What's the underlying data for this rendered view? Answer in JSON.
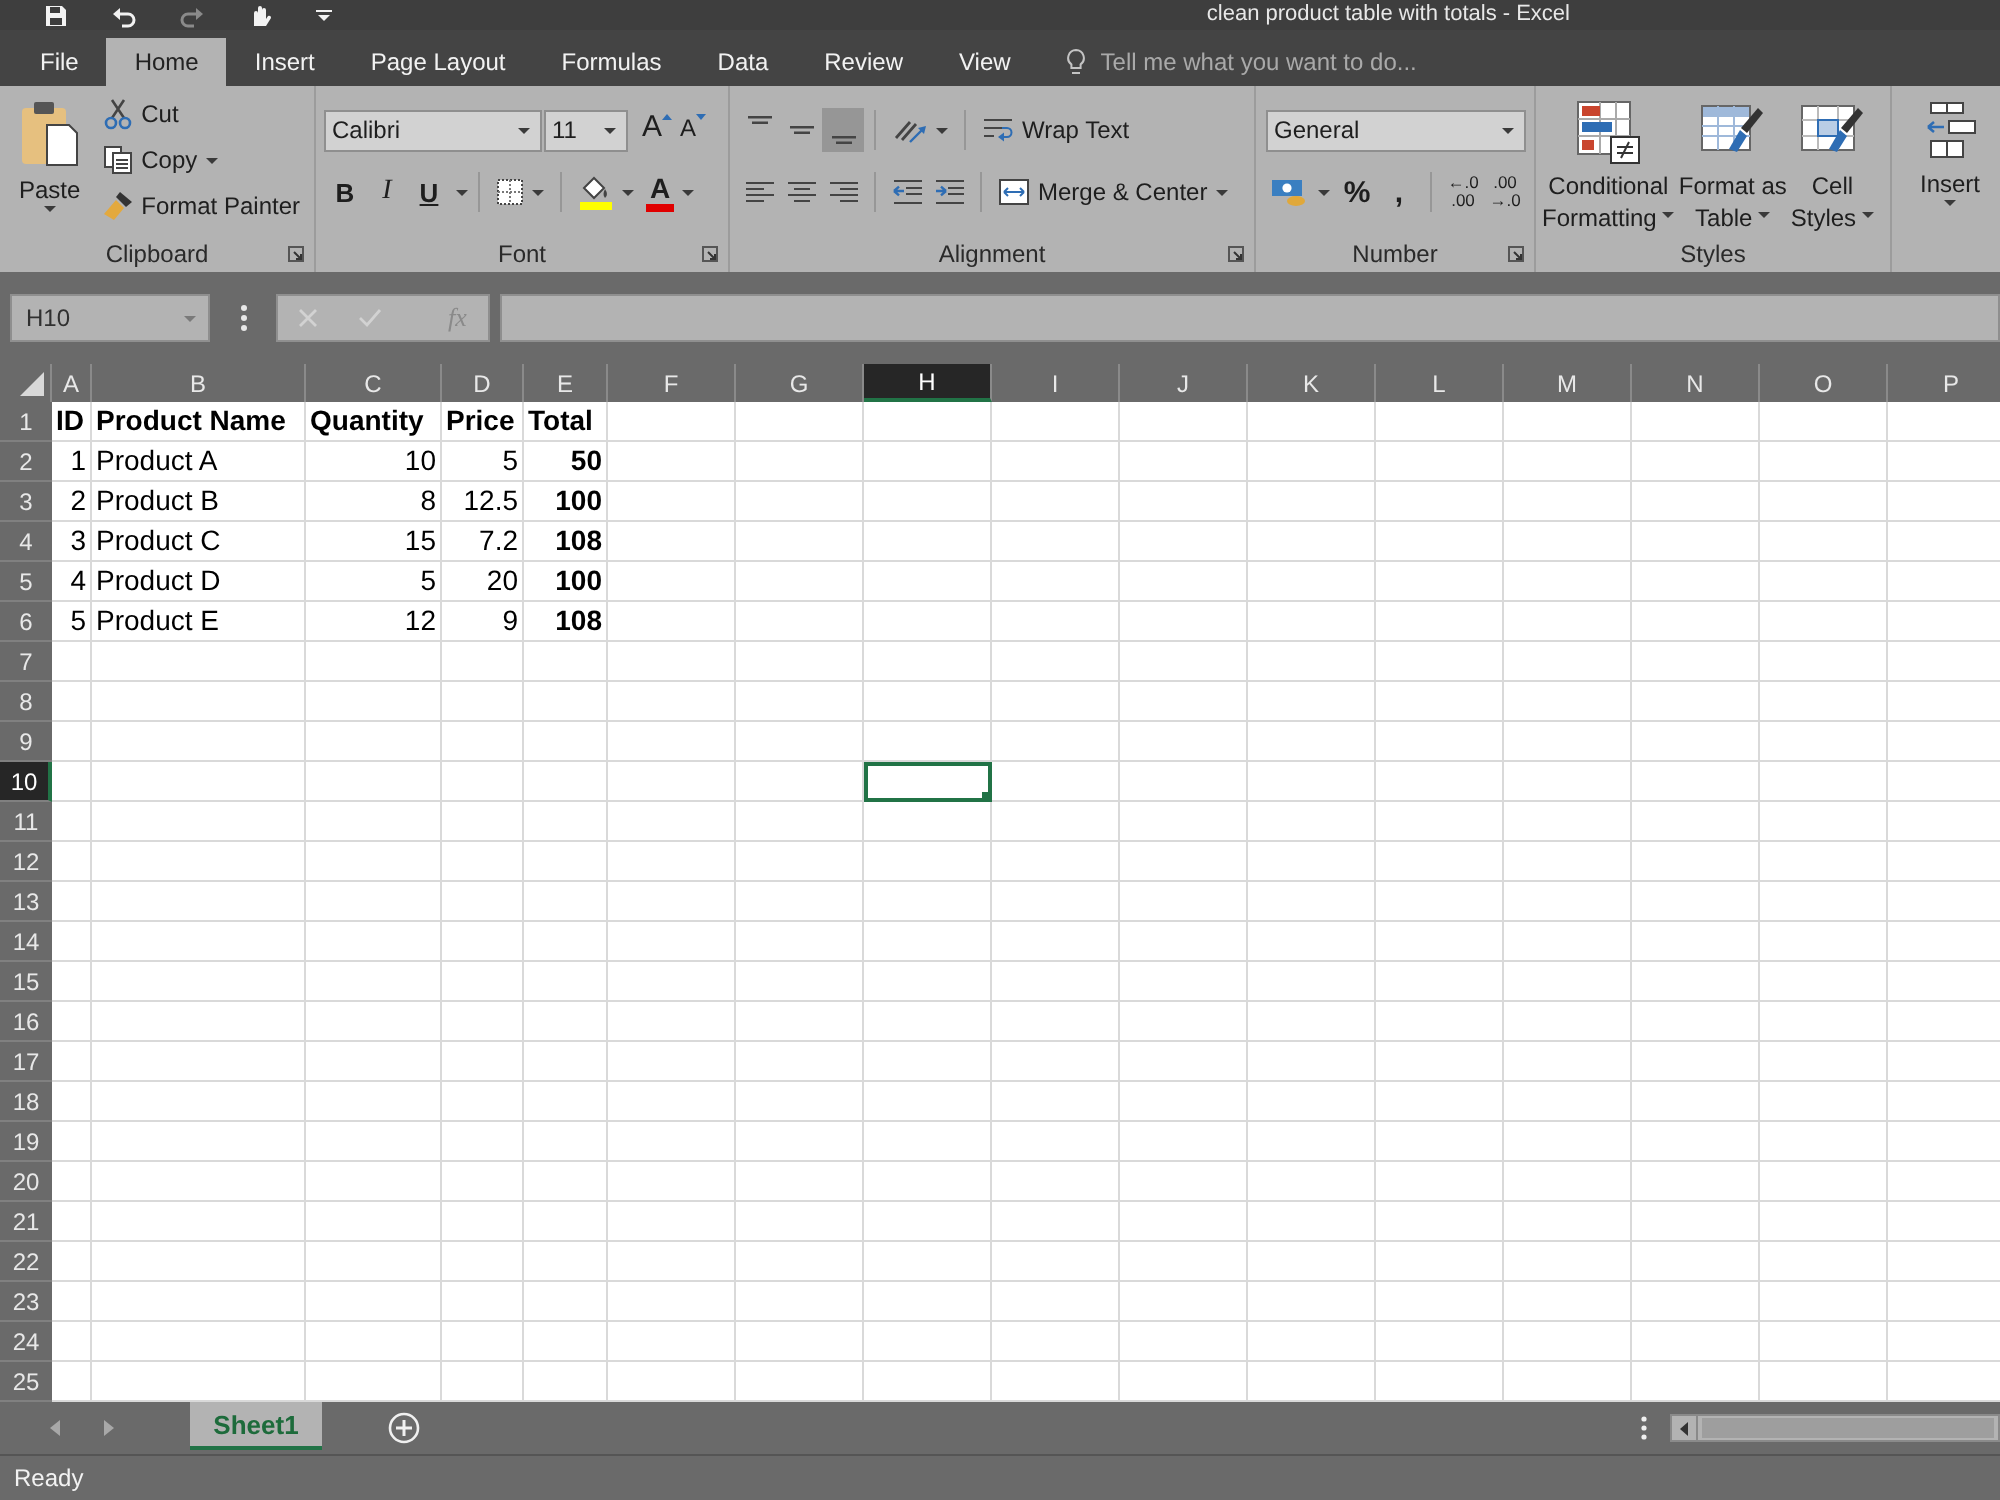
{
  "window": {
    "title": "clean product table with totals - Excel"
  },
  "ribbon_tabs": [
    {
      "label": "File",
      "selected": false
    },
    {
      "label": "Home",
      "selected": true
    },
    {
      "label": "Insert",
      "selected": false
    },
    {
      "label": "Page Layout",
      "selected": false
    },
    {
      "label": "Formulas",
      "selected": false
    },
    {
      "label": "Data",
      "selected": false
    },
    {
      "label": "Review",
      "selected": false
    },
    {
      "label": "View",
      "selected": false
    }
  ],
  "tell_me": {
    "placeholder": "Tell me what you want to do..."
  },
  "ribbon": {
    "clipboard": {
      "label": "Clipboard",
      "paste": "Paste",
      "cut": "Cut",
      "copy": "Copy",
      "format_painter": "Format Painter"
    },
    "font": {
      "label": "Font",
      "font_name": "Calibri",
      "font_size": "11",
      "grow": "A",
      "shrink": "A",
      "bold": "B",
      "italic": "I",
      "underline": "U",
      "font_color": "A"
    },
    "alignment": {
      "label": "Alignment",
      "vertical": [
        {
          "selected": false
        },
        {
          "selected": false
        },
        {
          "selected": true
        }
      ],
      "wrap_text": "Wrap Text",
      "merge": "Merge & Center"
    },
    "number": {
      "label": "Number",
      "format": "General",
      "percent": "%",
      "comma": ",",
      "decimals": [
        {
          "top": "←.0",
          "bottom": ".00"
        },
        {
          "top": ".00",
          "bottom": "→.0"
        }
      ]
    },
    "styles": {
      "label": "Styles",
      "buttons": [
        {
          "kind": "conditional",
          "lines": [
            "Conditional",
            "Formatting"
          ]
        },
        {
          "kind": "table",
          "lines": [
            "Format as",
            "Table"
          ]
        },
        {
          "kind": "cell",
          "lines": [
            "Cell",
            "Styles"
          ]
        }
      ]
    },
    "cells": {
      "insert": "Insert"
    }
  },
  "formula_bar": {
    "name_box": "H10",
    "function_label": "fx"
  },
  "sheet": {
    "columns": [
      {
        "label": "A",
        "selected": false
      },
      {
        "label": "B",
        "selected": false
      },
      {
        "label": "C",
        "selected": false
      },
      {
        "label": "D",
        "selected": false
      },
      {
        "label": "E",
        "selected": false
      },
      {
        "label": "F",
        "selected": false
      },
      {
        "label": "G",
        "selected": false
      },
      {
        "label": "H",
        "selected": true
      },
      {
        "label": "I",
        "selected": false
      },
      {
        "label": "J",
        "selected": false
      },
      {
        "label": "K",
        "selected": false
      },
      {
        "label": "L",
        "selected": false
      },
      {
        "label": "M",
        "selected": false
      },
      {
        "label": "N",
        "selected": false
      },
      {
        "label": "O",
        "selected": false
      },
      {
        "label": "P",
        "selected": false
      }
    ],
    "rows": [
      {
        "label": "1",
        "selected": false,
        "cells": [
          {
            "text": "ID",
            "kind": "text",
            "bold": true
          },
          {
            "text": "Product Name",
            "kind": "text",
            "bold": true
          },
          {
            "text": "Quantity",
            "kind": "text",
            "bold": true
          },
          {
            "text": "Price",
            "kind": "text",
            "bold": true
          },
          {
            "text": "Total",
            "kind": "text",
            "bold": true
          }
        ]
      },
      {
        "label": "2",
        "selected": false,
        "cells": [
          {
            "text": "1",
            "kind": "number",
            "bold": false
          },
          {
            "text": "Product A",
            "kind": "text",
            "bold": false
          },
          {
            "text": "10",
            "kind": "number",
            "bold": false
          },
          {
            "text": "5",
            "kind": "number",
            "bold": false
          },
          {
            "text": "50",
            "kind": "number",
            "bold": true
          }
        ]
      },
      {
        "label": "3",
        "selected": false,
        "cells": [
          {
            "text": "2",
            "kind": "number",
            "bold": false
          },
          {
            "text": "Product B",
            "kind": "text",
            "bold": false
          },
          {
            "text": "8",
            "kind": "number",
            "bold": false
          },
          {
            "text": "12.5",
            "kind": "number",
            "bold": false
          },
          {
            "text": "100",
            "kind": "number",
            "bold": true
          }
        ]
      },
      {
        "label": "4",
        "selected": false,
        "cells": [
          {
            "text": "3",
            "kind": "number",
            "bold": false
          },
          {
            "text": "Product C",
            "kind": "text",
            "bold": false
          },
          {
            "text": "15",
            "kind": "number",
            "bold": false
          },
          {
            "text": "7.2",
            "kind": "number",
            "bold": false
          },
          {
            "text": "108",
            "kind": "number",
            "bold": true
          }
        ]
      },
      {
        "label": "5",
        "selected": false,
        "cells": [
          {
            "text": "4",
            "kind": "number",
            "bold": false
          },
          {
            "text": "Product D",
            "kind": "text",
            "bold": false
          },
          {
            "text": "5",
            "kind": "number",
            "bold": false
          },
          {
            "text": "20",
            "kind": "number",
            "bold": false
          },
          {
            "text": "100",
            "kind": "number",
            "bold": true
          }
        ]
      },
      {
        "label": "6",
        "selected": false,
        "cells": [
          {
            "text": "5",
            "kind": "number",
            "bold": false
          },
          {
            "text": "Product E",
            "kind": "text",
            "bold": false
          },
          {
            "text": "12",
            "kind": "number",
            "bold": false
          },
          {
            "text": "9",
            "kind": "number",
            "bold": false
          },
          {
            "text": "108",
            "kind": "number",
            "bold": true
          }
        ]
      },
      {
        "label": "7",
        "selected": false
      },
      {
        "label": "8",
        "selected": false
      },
      {
        "label": "9",
        "selected": false
      },
      {
        "label": "10",
        "selected": true
      },
      {
        "label": "11",
        "selected": false
      },
      {
        "label": "12",
        "selected": false
      },
      {
        "label": "13",
        "selected": false
      },
      {
        "label": "14",
        "selected": false
      },
      {
        "label": "15",
        "selected": false
      },
      {
        "label": "16",
        "selected": false
      },
      {
        "label": "17",
        "selected": false
      },
      {
        "label": "18",
        "selected": false
      },
      {
        "label": "19",
        "selected": false
      },
      {
        "label": "20",
        "selected": false
      },
      {
        "label": "21",
        "selected": false
      },
      {
        "label": "22",
        "selected": false
      },
      {
        "label": "23",
        "selected": false
      },
      {
        "label": "24",
        "selected": false
      },
      {
        "label": "25",
        "selected": false
      }
    ]
  },
  "sheet_tabs": [
    {
      "label": "Sheet1",
      "selected": true
    }
  ],
  "status_bar": {
    "status": "Ready"
  }
}
